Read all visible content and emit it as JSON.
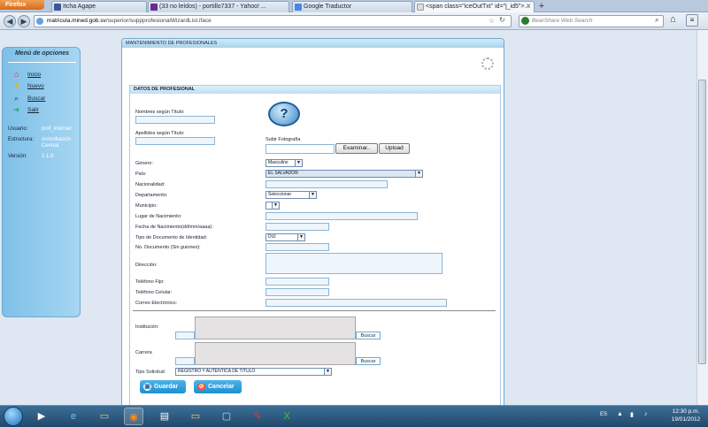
{
  "browser": {
    "app_button": "Firefox",
    "tabs": [
      {
        "label": "Itcha Agape",
        "color": "#3b5998",
        "active": false
      },
      {
        "label": "(33 no leídos) - portillo7337 - Yahoo! ...",
        "color": "#6a2c91",
        "active": false
      },
      {
        "label": "Google Traductor",
        "color": "#4a86e8",
        "active": false
      },
      {
        "label": "<span class=\"iceOutTxt\" id=\"j_id5\">...",
        "color": "#dddddd",
        "active": true
      }
    ],
    "url_host": "matricula.mined.gob.sv",
    "url_path": "/superior/suppprofesionalWizardList.iface",
    "search_placeholder": "BearShare Web Search"
  },
  "sidebar": {
    "title": "Menú de opciones",
    "items": [
      {
        "label": "Inicio",
        "icon": "home-icon"
      },
      {
        "label": "Nuevo",
        "icon": "star-icon"
      },
      {
        "label": "Buscar",
        "icon": "search-icon"
      },
      {
        "label": "Salir",
        "icon": "exit-icon"
      }
    ],
    "user_label": "Usuario:",
    "user_value": "prof_internet",
    "structure_label": "Estructura:",
    "structure_value": "Acreditación Central",
    "version_label": "Versión:",
    "version_value": "1.1.8"
  },
  "panel": {
    "title": "MANTENIMIENTO DE PROFESIONALES",
    "section_title": "DATOS DE PROFESIONAL",
    "labels": {
      "nombres": "Nombres según Título:",
      "apellidos": "Apellidos según Título:",
      "subir_foto": "Subir Fotografía",
      "genero": "Género:",
      "pais": "País:",
      "nacionalidad": "Nacionalidad:",
      "departamento": "Departamento:",
      "municipio": "Municipio:",
      "lugar_nac": "Lugar de Nacimiento:",
      "fecha_nac": "Fecha de Nacimiento(dd/mm/aaaa):",
      "tipo_doc": "Tipo de Documento de Identidad:",
      "no_doc": "No. Documento (Sin guiones):",
      "direccion": "Dirección:",
      "tel_fijo": "Teléfono Fijo:",
      "tel_celular": "Teléfono Celular:",
      "correo": "Correo Electrónico:",
      "institucion": "Institución:",
      "carrera": "Carrera",
      "tipo_solicitud": "Tipo Solicitud"
    },
    "values": {
      "genero": "Masculino",
      "pais": "EL SALVADOR",
      "departamento": "Seleccionar",
      "municipio": "",
      "tipo_doc": "DUI",
      "tipo_solicitud": "REGISTRO Y AUTENTICA DE TITULO"
    },
    "buttons": {
      "examinar": "Examinar..",
      "upload": "Upload",
      "buscar": "Buscar",
      "guardar": "Guardar",
      "cancelar": "Cancelar"
    }
  },
  "taskbar": {
    "lang": "ES",
    "time": "12:30 p.m.",
    "date": "19/01/2012"
  }
}
